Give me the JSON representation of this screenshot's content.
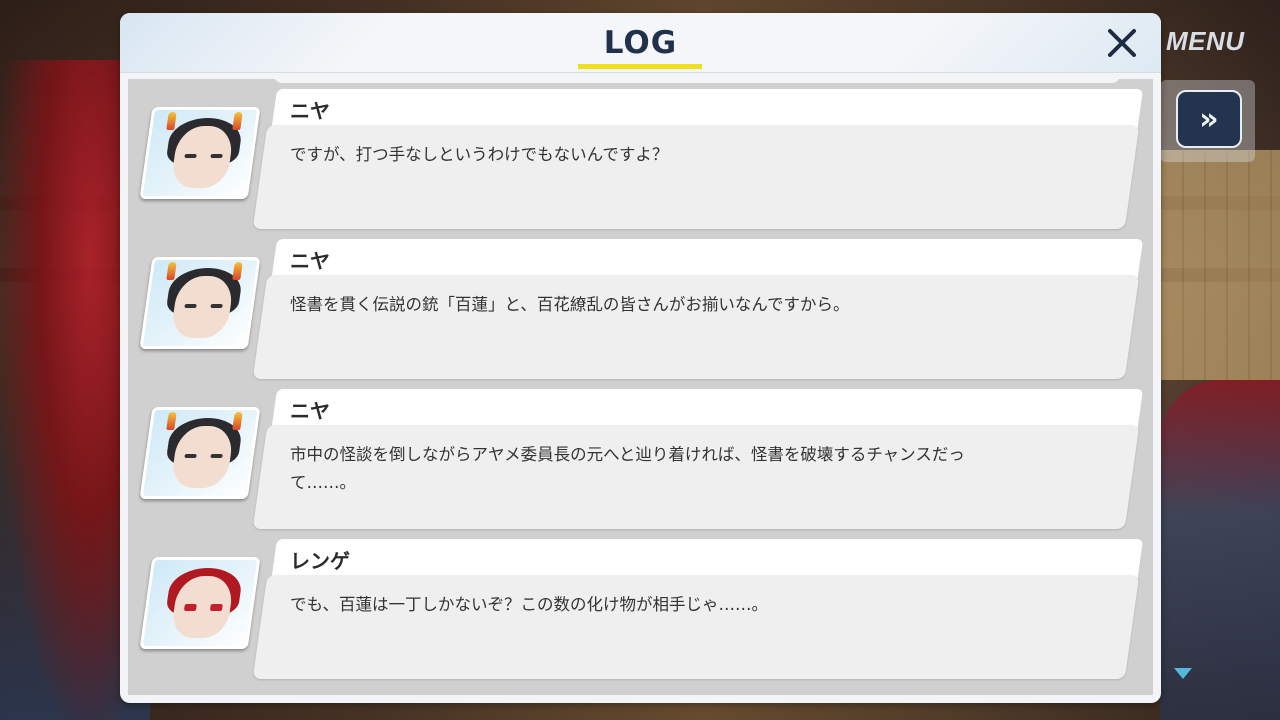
{
  "header": {
    "title": "LOG",
    "close_icon": "close-icon",
    "accent_color": "#f0e01c"
  },
  "controls": {
    "menu_label": "MENU",
    "skip_label": "»",
    "skip_icon": "fast-forward-icon",
    "scroll_icon": "scroll-down-icon"
  },
  "entries": [
    {
      "speaker": "ニヤ",
      "avatar": "nia-portrait",
      "text": "ですが、打つ手なしというわけでもないんですよ？"
    },
    {
      "speaker": "ニヤ",
      "avatar": "nia-portrait",
      "text": "怪書を貫く伝説の銃「百蓮」と、百花繚乱の皆さんがお揃いなんですから。"
    },
    {
      "speaker": "ニヤ",
      "avatar": "nia-portrait",
      "text": "市中の怪談を倒しながらアヤメ委員長の元へと辿り着ければ、怪書を破壊するチャンスだっ\nて……。"
    },
    {
      "speaker": "レンゲ",
      "avatar": "renge-portrait",
      "text": "でも、百蓮は一丁しかないぞ？この数の化け物が相手じゃ……。"
    }
  ]
}
